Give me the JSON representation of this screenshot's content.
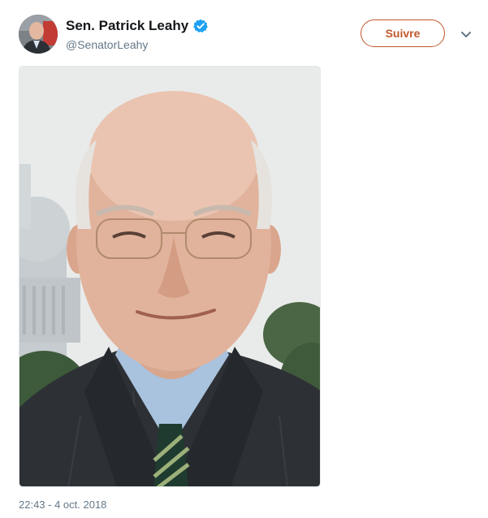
{
  "author": {
    "display_name": "Sen. Patrick Leahy",
    "handle": "@SenatorLeahy",
    "verified": true,
    "avatar_icon": "user-avatar"
  },
  "actions": {
    "follow_label": "Suivre",
    "more_icon": "chevron-down-icon"
  },
  "media": {
    "type": "photo",
    "description_icon": "portrait-photo"
  },
  "meta": {
    "timestamp": "22:43 - 4 oct. 2018"
  },
  "colors": {
    "name": "#14171a",
    "secondary_text": "#657786",
    "follow_accent": "#c0582b",
    "verified_badge": "#1da1f2",
    "media_border": "#e1e8ed"
  }
}
